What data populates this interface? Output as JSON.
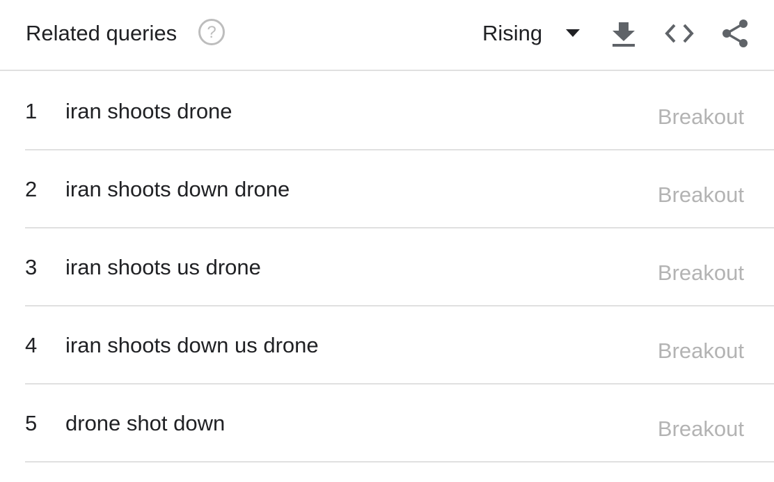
{
  "header": {
    "title": "Related queries",
    "help_icon": "help-circle-icon",
    "sort_selector": {
      "selected": "Rising",
      "icon": "caret-down-icon"
    },
    "tools": {
      "download_icon": "download-icon",
      "embed_icon": "code-embed-icon",
      "share_icon": "share-icon"
    }
  },
  "queries": [
    {
      "rank": "1",
      "query": "iran shoots drone",
      "value": "Breakout"
    },
    {
      "rank": "2",
      "query": "iran shoots down drone",
      "value": "Breakout"
    },
    {
      "rank": "3",
      "query": "iran shoots us drone",
      "value": "Breakout"
    },
    {
      "rank": "4",
      "query": "iran shoots down us drone",
      "value": "Breakout"
    },
    {
      "rank": "5",
      "query": "drone shot down",
      "value": "Breakout"
    }
  ],
  "colors": {
    "text": "#202124",
    "muted_value": "#b3b3b3",
    "icon": "#5f6368",
    "divider": "#e0e0e0",
    "help_icon": "#bdbdbd"
  }
}
